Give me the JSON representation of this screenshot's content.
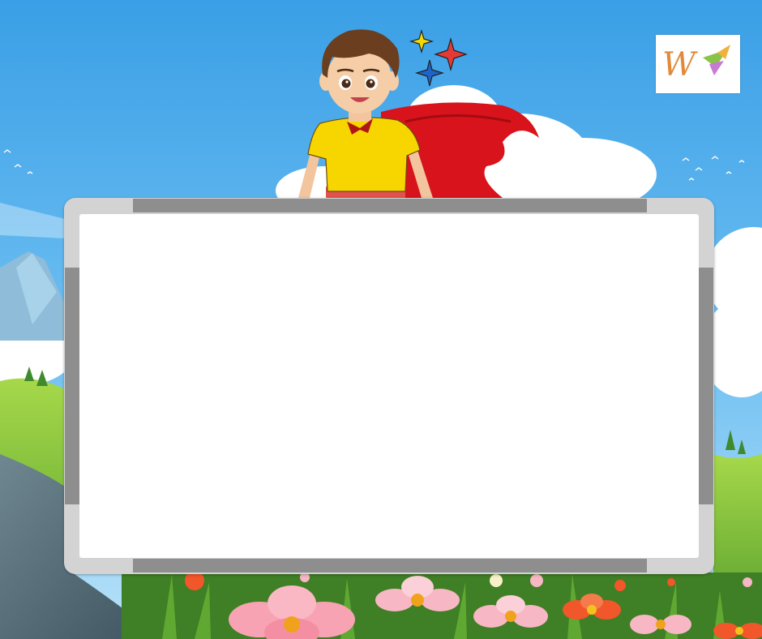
{
  "illustration": {
    "background": "sky-meadow-with-flowers",
    "character": "boy-superhero-with-red-cape",
    "board": "blank-whiteboard",
    "colors": {
      "sky_top": "#3a9fe6",
      "sky_bottom": "#a9daf7",
      "shirt": "#f7d600",
      "cape": "#d8131b",
      "board_frame": "#d3d3d3",
      "board_rail": "#8e8e8e",
      "board_surface": "#ffffff"
    }
  },
  "logo": {
    "icon": "w-logo-icon",
    "colors": [
      "#e08a3c",
      "#c77bd4",
      "#8bc34a"
    ]
  },
  "sparkles": [
    "#f5d800",
    "#e53935",
    "#1e63c6"
  ]
}
